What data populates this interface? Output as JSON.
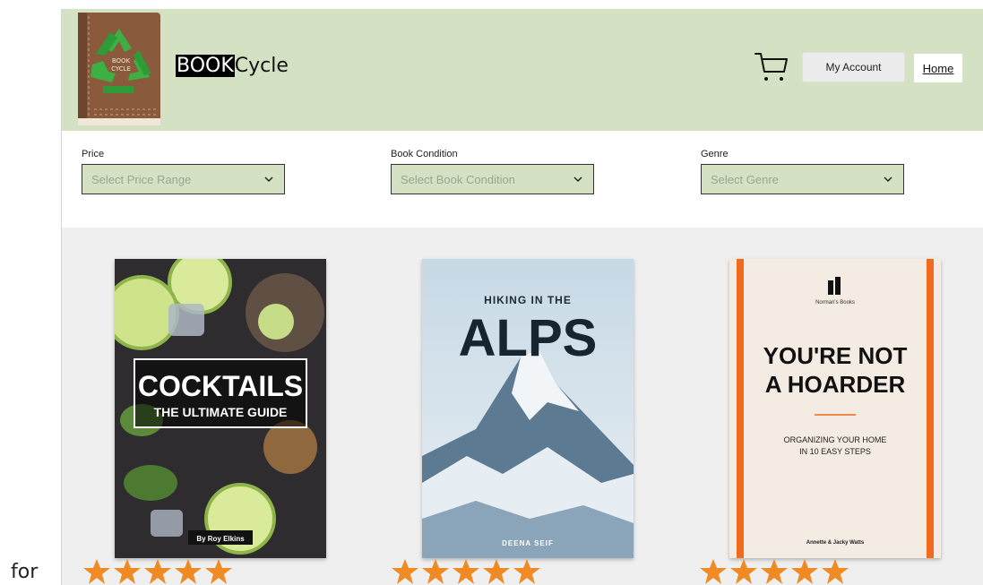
{
  "outer": {
    "left_text": "for"
  },
  "header": {
    "logo_text_top": "BOOK",
    "logo_text_bottom": "CYCLE",
    "brand_highlight": "BOOK",
    "brand_rest": "Cycle",
    "account_label": "My Account",
    "home_label": "Home",
    "colors": {
      "header_bg": "#d4e1c3",
      "logo_brown": "#8a5a3c",
      "recycle_green": "#3cb043"
    }
  },
  "filters": [
    {
      "label": "Price",
      "placeholder": "Select Price Range"
    },
    {
      "label": "Book Condition",
      "placeholder": "Select Book Condition"
    },
    {
      "label": "Genre",
      "placeholder": "Select Genre"
    }
  ],
  "books": [
    {
      "title_line1": "COCKTAILS",
      "title_line2": "THE ULTIMATE GUIDE",
      "author": "By Roy Elkins",
      "rating": 5
    },
    {
      "title_top": "HIKING IN THE",
      "title_big": "ALPS",
      "author": "DEENA SEIF",
      "rating": 5
    },
    {
      "publisher": "Norman's Books",
      "title_line1": "YOU'RE NOT",
      "title_line2": "A HOARDER",
      "subtitle_line1": "ORGANIZING YOUR HOME",
      "subtitle_line2": "IN 10 EASY STEPS",
      "author": "Annette & Jacky Watts",
      "rating": 5
    }
  ],
  "star_color": "#f08a24",
  "icons": [
    "recycle-icon",
    "cart-icon",
    "chevron-down-icon",
    "star-icon"
  ]
}
